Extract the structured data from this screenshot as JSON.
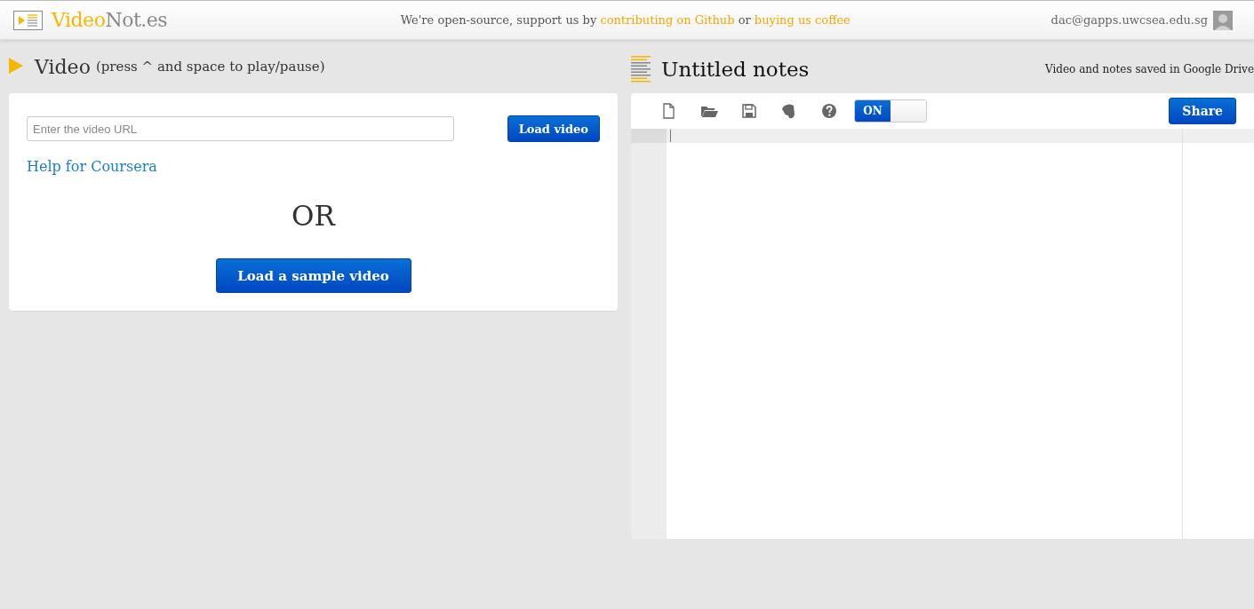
{
  "header": {
    "brand": [
      {
        "text": "Video",
        "kind": "accent"
      },
      {
        "text": "Not.es",
        "kind": "plain"
      }
    ],
    "message": [
      {
        "text": "We're open-source, support us by ",
        "kind": "text"
      },
      {
        "text": "contributing on Github",
        "kind": "link"
      },
      {
        "text": " or ",
        "kind": "text"
      },
      {
        "text": "buying us coffee",
        "kind": "link"
      }
    ],
    "user_email": "dac@gapps.uwcsea.edu.sg"
  },
  "video_panel": {
    "title": "Video",
    "hint": "(press ^ and space to play/pause)",
    "url_field": {
      "placeholder": "Enter the video URL"
    },
    "load_button": "Load video",
    "help_link": "Help for Coursera",
    "separator": "OR",
    "sample_button": "Load a sample video"
  },
  "notes_panel": {
    "title": "Untitled notes",
    "save_status": "Video and notes saved in Google Drive",
    "toolbar": [
      {
        "kind": "new"
      },
      {
        "kind": "open"
      },
      {
        "kind": "save"
      },
      {
        "kind": "evernote"
      },
      {
        "kind": "help"
      }
    ],
    "toggle": {
      "label": "ON",
      "on": true
    },
    "share_button": "Share"
  }
}
